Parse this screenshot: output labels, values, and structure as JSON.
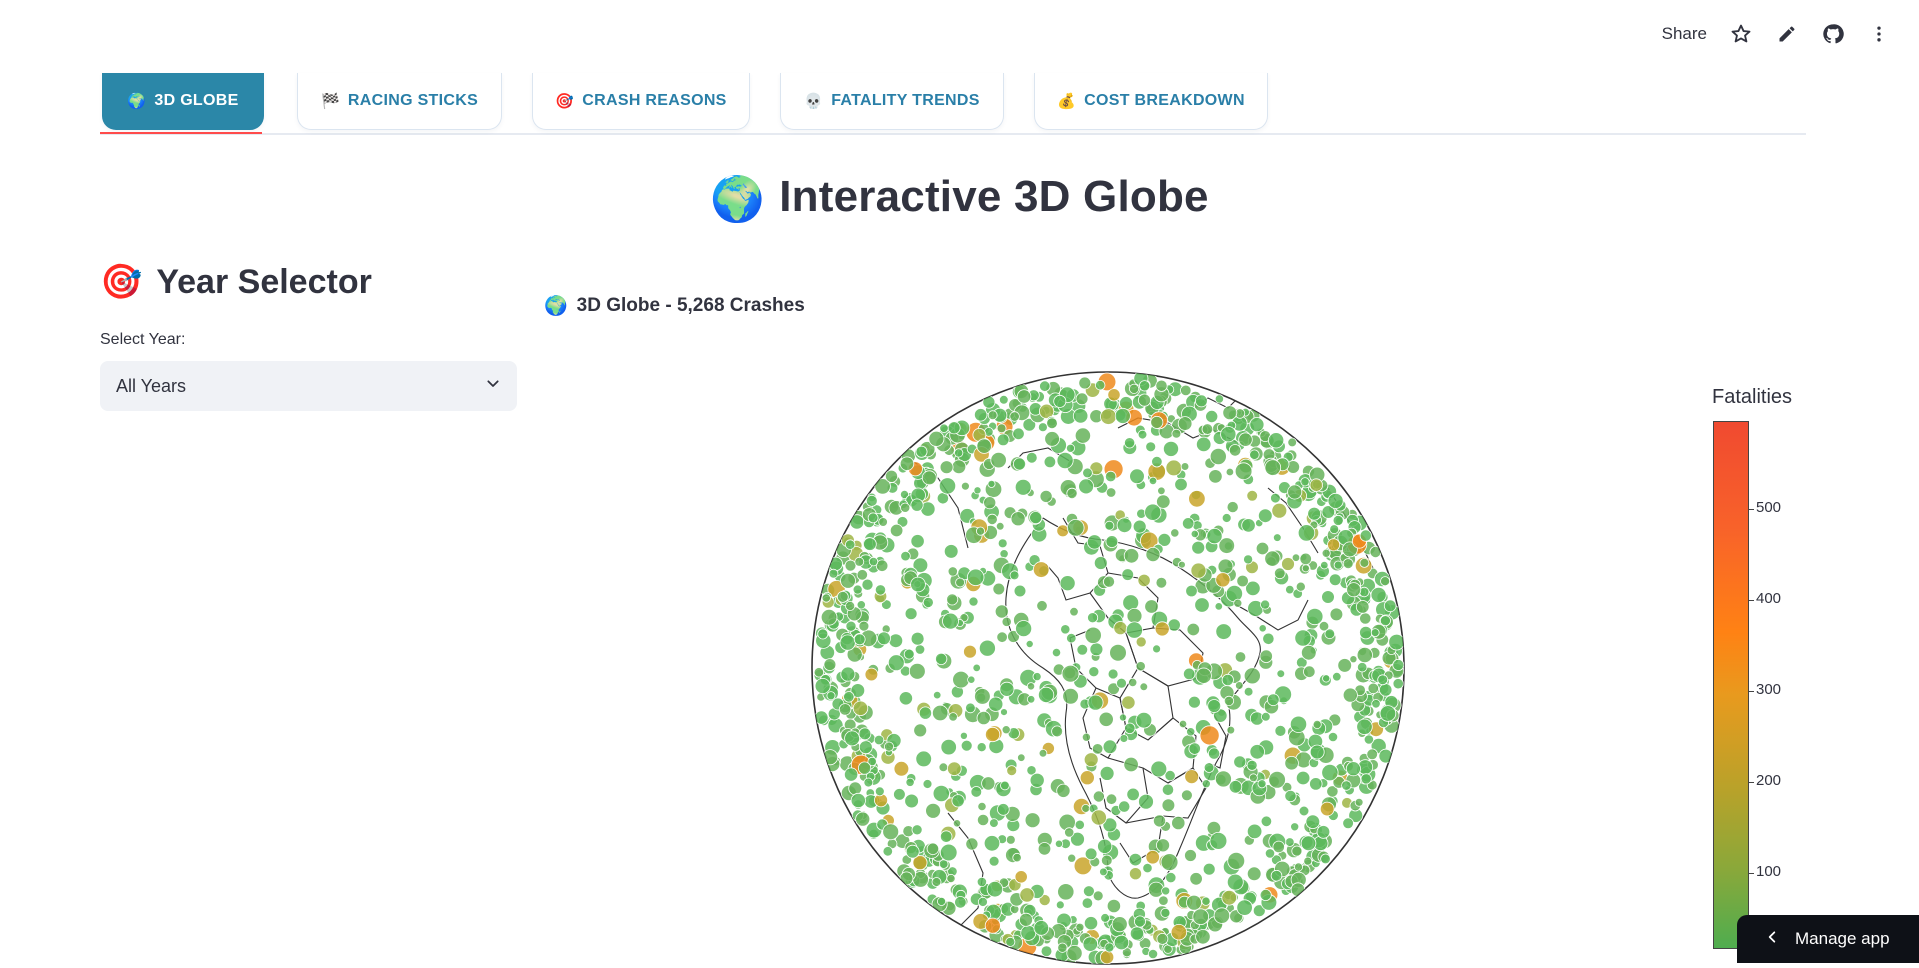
{
  "toolbar": {
    "share_label": "Share"
  },
  "tabs": [
    {
      "icon": "🌍",
      "label": "3D GLOBE",
      "active": true
    },
    {
      "icon": "🏁",
      "label": "RACING STICKS",
      "active": false
    },
    {
      "icon": "🎯",
      "label": "CRASH REASONS",
      "active": false
    },
    {
      "icon": "💀",
      "label": "FATALITY TRENDS",
      "active": false
    },
    {
      "icon": "💰",
      "label": "COST BREAKDOWN",
      "active": false
    }
  ],
  "page": {
    "title_icon": "🌍",
    "title": "Interactive 3D Globe"
  },
  "year_selector": {
    "heading_icon": "🎯",
    "heading": "Year Selector",
    "label": "Select Year:",
    "value": "All Years"
  },
  "chart_header": {
    "icon": "🌍",
    "title": "3D Globe - 5,268 Crashes"
  },
  "colorbar": {
    "title": "Fatalities",
    "ticks": [
      "100",
      "200",
      "300",
      "400",
      "500"
    ],
    "colors": [
      "#4fad4f",
      "#b8a22a",
      "#ff8214",
      "#f04a30"
    ]
  },
  "chart_data": {
    "type": "scatter",
    "projection": "orthographic",
    "point_count_label": "5,268",
    "color_variable": "Fatalities",
    "color_range": [
      0,
      580
    ],
    "color_ticks": [
      100,
      200,
      300,
      400,
      500
    ]
  },
  "manage_app": {
    "label": "Manage app"
  }
}
